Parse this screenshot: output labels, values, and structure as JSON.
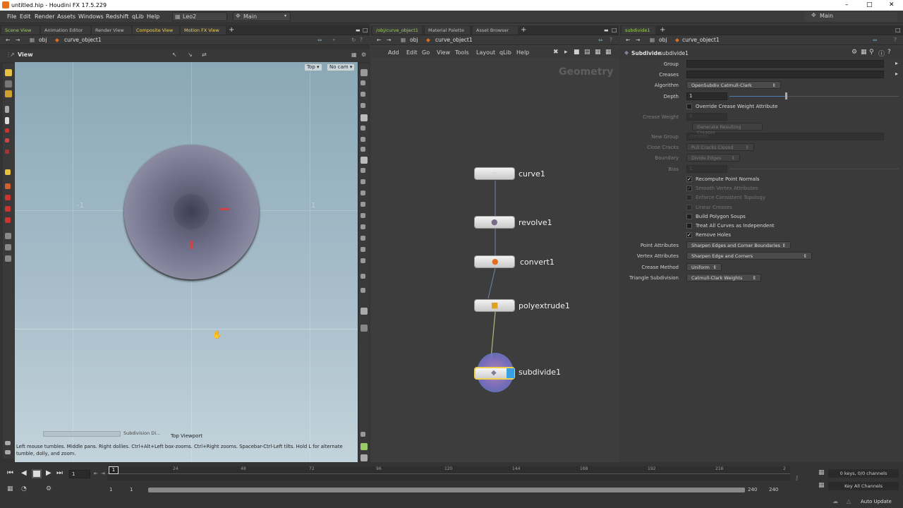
{
  "window": {
    "title": "untitled.hip - Houdini FX 17.5.229"
  },
  "menu": {
    "items": [
      "File",
      "Edit",
      "Render",
      "Assets",
      "Windows",
      "Redshift",
      "qLib",
      "Help"
    ],
    "shelf_set": "Leo2",
    "desktop_left": "Main",
    "desktop_right": "Main"
  },
  "left_pane": {
    "tabs": [
      "Scene View",
      "Animation Editor",
      "Render View",
      "Composite View",
      "Motion FX View"
    ],
    "path": [
      "obj",
      "curve_object1"
    ],
    "view_label": "View",
    "cam_top": "Top",
    "cam_none": "No cam",
    "grid_label_left": "-1",
    "grid_label_right": "1",
    "viewport_label": "Top Viewport",
    "subdiv_tag": "Subdivision Di...",
    "hint": "Left mouse tumbles. Middle pans. Right dollies. Ctrl+Alt+Left box-zooms. Ctrl+Right zooms. Spacebar-Ctrl-Left tilts. Hold L for alternate tumble, dolly, and zoom."
  },
  "network": {
    "tabs": [
      "/obj/curve_object1",
      "Material Palette",
      "Asset Browser"
    ],
    "path": [
      "obj",
      "curve_object1"
    ],
    "menu": [
      "Add",
      "Edit",
      "Go",
      "View",
      "Tools",
      "Layout",
      "qLib",
      "Help"
    ],
    "context": "Geometry",
    "nodes": [
      {
        "name": "curve1",
        "icon_color": "#888888"
      },
      {
        "name": "revolve1",
        "icon_color": "#7a6a8a"
      },
      {
        "name": "convert1",
        "icon_color": "#e07020"
      },
      {
        "name": "polyextrude1",
        "icon_color": "#e0a020"
      },
      {
        "name": "subdivide1",
        "icon_color": "#8a7a9a"
      }
    ]
  },
  "params": {
    "tab": "subdivide1",
    "path": [
      "obj",
      "curve_object1"
    ],
    "node_type": "Subdivide",
    "node_name": "subdivide1",
    "group_label": "Group",
    "creases_label": "Creases",
    "algorithm_label": "Algorithm",
    "algorithm_value": "OpenSubdiv Catmull-Clark",
    "depth_label": "Depth",
    "depth_value": "1",
    "override_label": "Override Crease Weight Attribute",
    "crease_weight_label": "Crease Weight",
    "crease_weight_value": "0",
    "gen_creases_label": "Generate Resulting Creases",
    "new_group_label": "New Group",
    "new_group_value": "creases",
    "close_cracks_label": "Close Cracks",
    "close_cracks_value": "Pull Cracks Closed",
    "boundary_label": "Boundary",
    "boundary_value": "Divide Edges",
    "bias_label": "Bias",
    "bias_value": "1",
    "recompute_label": "Recompute Point Normals",
    "smooth_label": "Smooth Vertex Attributes",
    "enforce_label": "Enforce Consistent Topology",
    "linear_label": "Linear Creases",
    "poly_soups_label": "Build Polygon Soups",
    "treat_curves_label": "Treat All Curves as Independent",
    "remove_holes_label": "Remove Holes",
    "point_attr_label": "Point Attributes",
    "point_attr_value": "Sharpen Edges and Corner Boundaries",
    "vertex_attr_label": "Vertex Attributes",
    "vertex_attr_value": "Sharpen Edge and Corners",
    "crease_method_label": "Crease Method",
    "crease_method_value": "Uniform",
    "triangle_label": "Triangle Subdivision",
    "triangle_value": "Catmull-Clark Weights"
  },
  "timeline": {
    "current_frame": "1",
    "frame_field": "1",
    "ticks": [
      "24",
      "48",
      "72",
      "96",
      "120",
      "144",
      "168",
      "192",
      "216"
    ],
    "end_tick": "2",
    "range_start": "1",
    "range_start2": "1",
    "range_end": "240",
    "range_end2": "240",
    "keys_info": "0 keys, 0/0 channels",
    "key_all": "Key All Channels",
    "auto_update": "Auto Update"
  }
}
